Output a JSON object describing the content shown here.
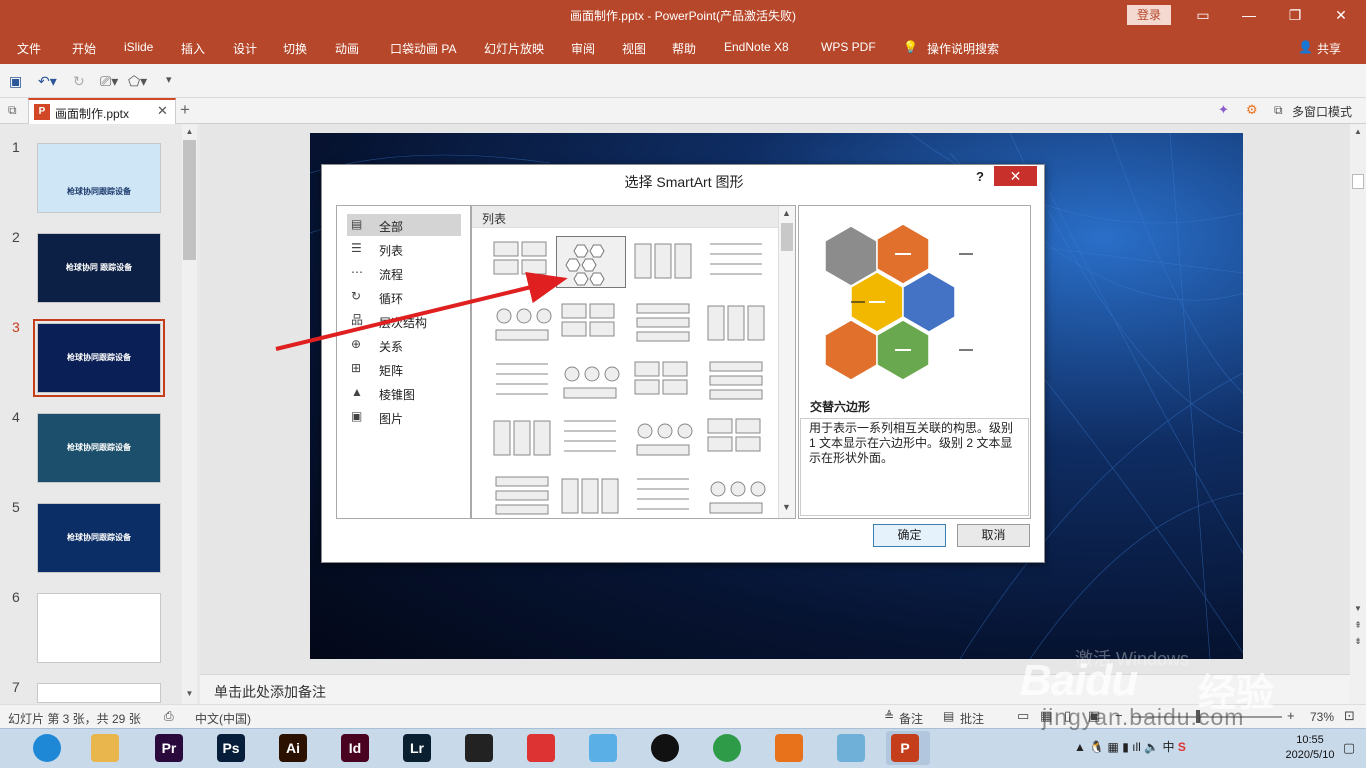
{
  "window": {
    "title": "画面制作.pptx  -  PowerPoint(产品激活失败)",
    "login_label": "登录",
    "share_label": "共享"
  },
  "menu": [
    "文件",
    "开始",
    "iSlide",
    "插入",
    "设计",
    "切换",
    "动画",
    "口袋动画 PA",
    "幻灯片放映",
    "审阅",
    "视图",
    "帮助",
    "EndNote X8",
    "WPS PDF",
    "操作说明搜索"
  ],
  "doc_tab": {
    "label": "画面制作.pptx",
    "multi_window": "多窗口模式"
  },
  "thumbnails": [
    {
      "num": "1",
      "text": "枪球协同跟踪设备",
      "bg": "#cfe6f6"
    },
    {
      "num": "2",
      "text": "枪球协同 跟踪设备",
      "bg": "#0c1f44"
    },
    {
      "num": "3",
      "text": "枪球协同跟踪设备",
      "bg": "#0a1f55"
    },
    {
      "num": "4",
      "text": "枪球协同跟踪设备",
      "bg": "#1b4f6b"
    },
    {
      "num": "5",
      "text": "枪球协同跟踪设备",
      "bg": "#0b2e66"
    },
    {
      "num": "6",
      "text": "",
      "bg": "#ffffff"
    },
    {
      "num": "7",
      "text": "",
      "bg": "#ffffff"
    }
  ],
  "selected_slide": "3",
  "notes_placeholder": "单击此处添加备注",
  "status": {
    "slide_info": "幻灯片 第 3 张，共 29 张",
    "language": "中文(中国)",
    "notes": "备注",
    "comments": "批注",
    "zoom": "73%"
  },
  "taskbar": {
    "apps": [
      {
        "name": "browser",
        "label": "",
        "color": "#1e88d6"
      },
      {
        "name": "explorer",
        "label": "",
        "color": "#e8b64c"
      },
      {
        "name": "premiere",
        "label": "Pr",
        "color": "#2a0a3d"
      },
      {
        "name": "photoshop",
        "label": "Ps",
        "color": "#061e3a"
      },
      {
        "name": "illustrator",
        "label": "Ai",
        "color": "#2b1200"
      },
      {
        "name": "indesign",
        "label": "Id",
        "color": "#49021f"
      },
      {
        "name": "lightroom",
        "label": "Lr",
        "color": "#0a1f2f"
      },
      {
        "name": "video",
        "label": "",
        "color": "#222222"
      },
      {
        "name": "app-red",
        "label": "",
        "color": "#d33"
      },
      {
        "name": "app-blue",
        "label": "",
        "color": "#5ab0e6"
      },
      {
        "name": "qq",
        "label": "",
        "color": "#111"
      },
      {
        "name": "chrome",
        "label": "",
        "color": "#2e9b48"
      },
      {
        "name": "app-orange",
        "label": "",
        "color": "#e8721c"
      },
      {
        "name": "app-note",
        "label": "",
        "color": "#6fb0d8"
      },
      {
        "name": "powerpoint",
        "label": "P",
        "color": "#c43e1c"
      }
    ],
    "tray_ime": "中",
    "time": "10:55",
    "date": "2020/5/10"
  },
  "dialog": {
    "title": "选择 SmartArt 图形",
    "help": "?",
    "categories": [
      "全部",
      "列表",
      "流程",
      "循环",
      "层次结构",
      "关系",
      "矩阵",
      "棱锥图",
      "图片"
    ],
    "selected_category": "全部",
    "gallery_header": "列表",
    "preview_title": "交替六边形",
    "preview_desc": "用于表示一系列相互关联的构思。级别 1 文本显示在六边形中。级别 2 文本显示在形状外面。",
    "ok": "确定",
    "cancel": "取消"
  },
  "watermark": {
    "brand": "Baidu",
    "cn": "经验",
    "url": "jingyan.baidu.com",
    "activate": "激活 Windows"
  },
  "colors": {
    "accent": "#b7472a",
    "hex_gray": "#8c8c8c",
    "hex_orange": "#e0702c",
    "hex_yellow": "#f2b800",
    "hex_blue": "#4472c4",
    "hex_green": "#6aa84f",
    "arrow": "#e02020"
  }
}
